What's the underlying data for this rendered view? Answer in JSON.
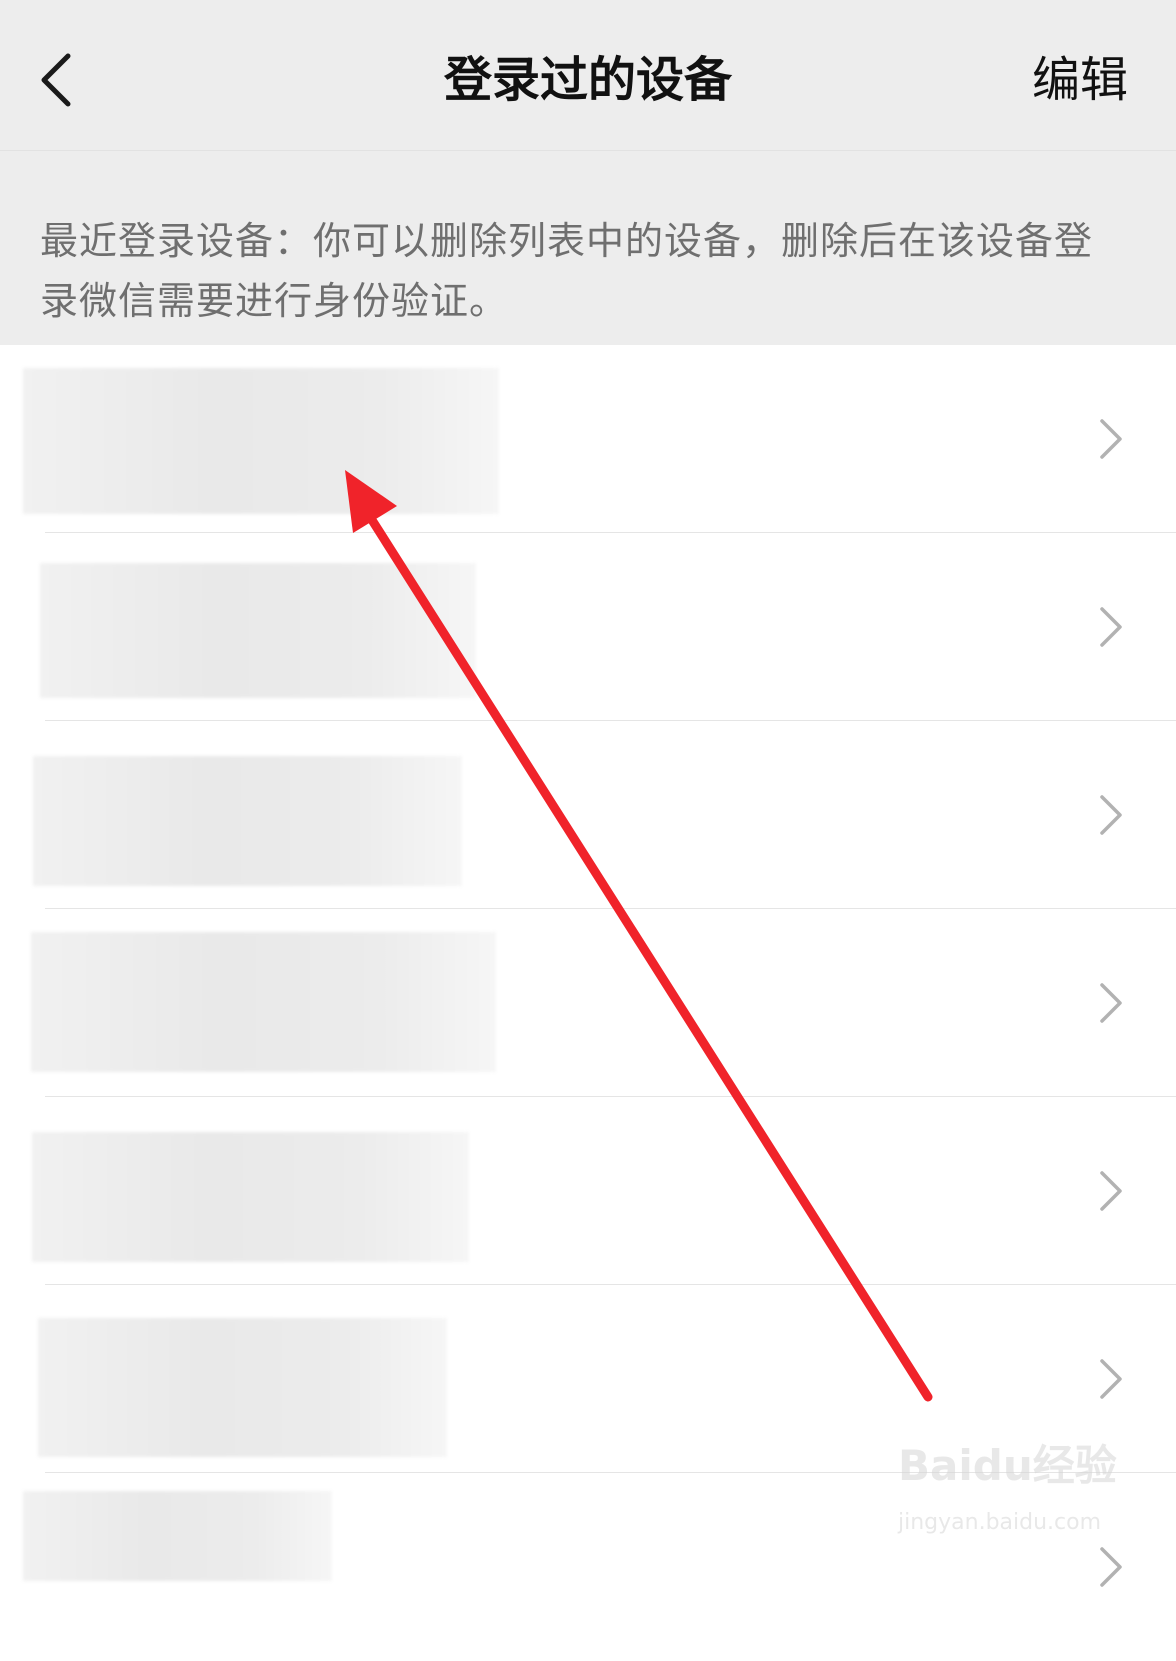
{
  "navbar": {
    "back_icon": "chevron-left-icon",
    "title": "登录过的设备",
    "edit_label": "编辑"
  },
  "notice": {
    "text": "最近登录设备：你可以删除列表中的设备，删除后在该设备登录微信需要进行身份验证。"
  },
  "devices": [
    {
      "name": "",
      "redacted": true
    },
    {
      "name": "",
      "redacted": true
    },
    {
      "name": "",
      "redacted": true
    },
    {
      "name": "",
      "redacted": true
    },
    {
      "name": "",
      "redacted": true
    },
    {
      "name": "",
      "redacted": true
    },
    {
      "name": "",
      "redacted": true
    }
  ],
  "annotation": {
    "type": "arrow",
    "color": "#f0232a"
  },
  "watermark": {
    "brand": "Baidu经验",
    "url": "jingyan.baidu.com"
  },
  "colors": {
    "header_bg": "#ededed",
    "list_bg": "#ffffff",
    "text_primary": "#111111",
    "text_secondary": "#6f6f6f",
    "divider": "#e5e5e5",
    "chevron": "#b2b2b2"
  }
}
